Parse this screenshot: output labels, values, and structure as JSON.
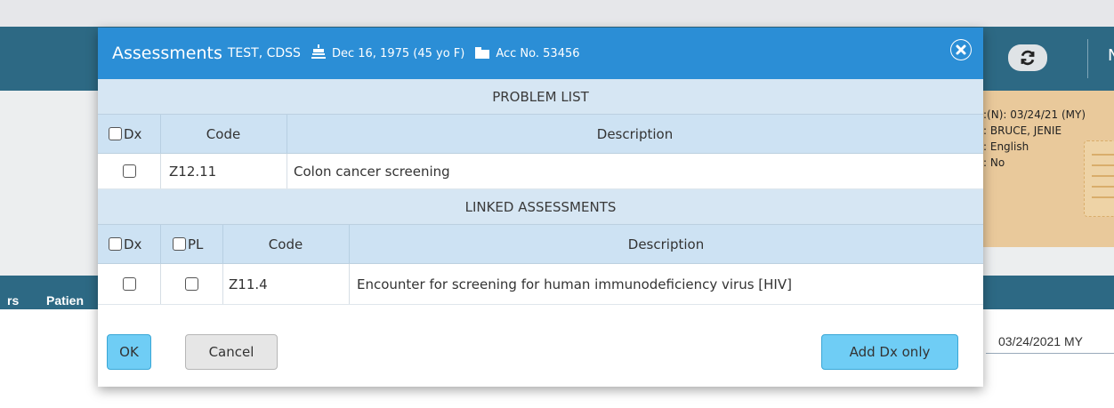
{
  "modal": {
    "title": "Assessments",
    "patient_name": "TEST, CDSS",
    "dob": "Dec 16, 1975 (45 yo F)",
    "acc": "Acc No. 53456"
  },
  "problem_list": {
    "heading": "PROBLEM LIST",
    "col_dx": "Dx",
    "col_code": "Code",
    "col_description": "Description",
    "rows": [
      {
        "code": "Z12.11",
        "description": "Colon cancer screening"
      }
    ]
  },
  "linked_assessments": {
    "heading": "LINKED ASSESSMENTS",
    "col_dx": "Dx",
    "col_pl": "PL",
    "col_code": "Code",
    "col_description": "Description",
    "rows": [
      {
        "code": "Z11.4",
        "description": "Encounter for screening for human immunodeficiency virus [HIV]"
      }
    ]
  },
  "buttons": {
    "ok": "OK",
    "cancel": "Cancel",
    "add_dx_only": "Add Dx only"
  },
  "background": {
    "appbar_letter": "N",
    "card_lines": [
      ":(N): 03/24/21 (MY)",
      ": BRUCE, JENIE",
      ": English",
      ": No"
    ],
    "nav_left": "rs",
    "nav_patient": "Patien",
    "date_field": "03/24/2021 MY"
  },
  "colors": {
    "header_blue": "#2b8ed6",
    "section_blue": "#d6e6f3",
    "appbar_teal": "#2d6984",
    "button_blue": "#6fcdf5",
    "card_tan": "#e9c99b"
  }
}
